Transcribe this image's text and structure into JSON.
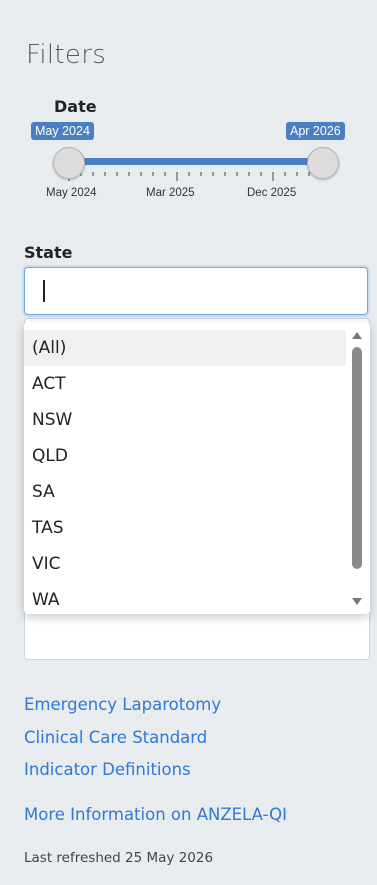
{
  "filters": {
    "title": "Filters"
  },
  "date_slider": {
    "label": "Date",
    "from_value": "May 2024",
    "to_value": "Apr 2026",
    "tick_labels": [
      "May 2024",
      "Mar 2025",
      "Dec 2025"
    ]
  },
  "state": {
    "label": "State",
    "input_value": "",
    "options": [
      "(All)",
      "ACT",
      "NSW",
      "QLD",
      "SA",
      "TAS",
      "VIC",
      "WA"
    ],
    "highlighted_option": "(All)"
  },
  "links": {
    "standard_line1": "Emergency Laparotomy",
    "standard_line2": "Clinical Care Standard",
    "standard_line3": "Indicator Definitions",
    "more_info": "More Information on ANZELA-QI"
  },
  "footer": {
    "last_refreshed": "Last refreshed 25 May 2026"
  },
  "colors": {
    "accent": "#4a7fc1",
    "link": "#2f78d6",
    "panel_bg": "#e9ecef"
  }
}
